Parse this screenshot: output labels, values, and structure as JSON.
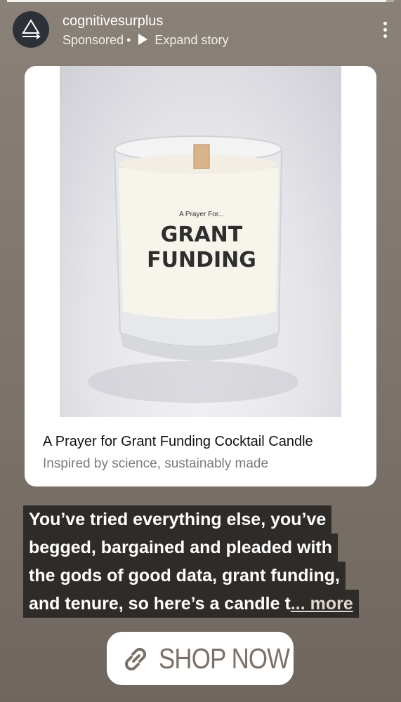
{
  "story": {
    "progress": 0.98
  },
  "header": {
    "username": "cognitivesurplus",
    "sponsored_label": "Sponsored",
    "separator": "•",
    "expand_label": "Expand story",
    "avatar_icon": "triangle-logo-icon",
    "menu_icon": "more-vertical-icon"
  },
  "product": {
    "image_text_small": "A Prayer For...",
    "image_text_line1": "GRANT",
    "image_text_line2": "FUNDING",
    "title": "A Prayer for Grant Funding Cocktail Candle",
    "subtitle": "Inspired by science, sustainably made"
  },
  "caption": {
    "lines": [
      "You’ve tried everything else, you’ve",
      "begged, bargained and pleaded with",
      "the gods of good data, grant funding,",
      "and tenure, so here’s a candle t"
    ],
    "more_label": "... more"
  },
  "cta": {
    "label": "SHOP NOW",
    "icon": "link-icon"
  },
  "colors": {
    "background": "#7d746b",
    "caption_bg": "#2f2b28",
    "cta_text": "#7b7168"
  }
}
